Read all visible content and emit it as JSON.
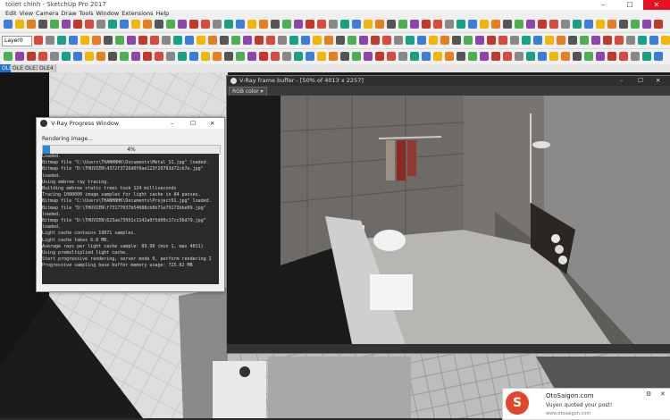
{
  "window": {
    "title": "toilet chinh - SketchUp Pro 2017",
    "min": "–",
    "max": "☐",
    "close": "✕"
  },
  "menu": [
    "Edit",
    "View",
    "Camera",
    "Draw",
    "Tools",
    "Window",
    "Extensions",
    "Help"
  ],
  "layer": {
    "current": "Layer0"
  },
  "scene_tabs": [
    {
      "label": "OLE1"
    },
    {
      "label": "OLE2"
    },
    {
      "label": "OLE3"
    },
    {
      "label": "OLE4"
    }
  ],
  "progress_window": {
    "title": "V-Ray Progress Window",
    "status": "Rendering image...",
    "percent_label": "4%",
    "percent": 0.04,
    "log": [
      "Loaded.",
      "Bitmap file \"C:\\Users\\THANHNHK\\Documents\\Metal_S1.jpg\" loaded.",
      "Bitmap file \"D:\\THUVIEN\\4372f3726d0f0ae123f20763d72cb7e.jpg\"",
      "loaded.",
      "Using embree ray tracing.",
      "Building embree static trees took 124 milliseconds",
      "Tracing 1000000 image samples for light cache in 84 passes.",
      "Bitmap file \"C:\\Users\\THANHNHK\\Documents\\Project01.jpg\" loaded.",
      "Bitmap file \"D:\\THUVIEN\\f73177037b54088cb0b71e79173bbe09.jpg\"",
      "loaded.",
      "Bitmap file \"D:\\THUVIEN\\623ae73501c1142a0f5d00c17cc36d79.jpg\"",
      "loaded.",
      "Light cache contains 19871 samples.",
      "Light cache takes 6.6 MB.",
      "Average rays per light cache sample: 89.98 (min 1, max 4011)",
      "Using premultiplied light cache.",
      "Start progressive rendering, server mode 0, perform rendering I",
      "Progressive sampling base buffer memory usage: 725.82 MB"
    ]
  },
  "frame_buffer": {
    "title": "V-Ray frame buffer - [50% of 4013 x 2257]",
    "channel": "RGB color"
  },
  "notification": {
    "site": "OtoSaigon.com",
    "message": "Vuyen quoted your post!",
    "url": "www.otosaigon.com",
    "gear": "⚙",
    "close": "✕"
  },
  "colors": {
    "accent": "#1e6fd0",
    "progress": "#2f86d6",
    "logo": "#e2462a"
  }
}
